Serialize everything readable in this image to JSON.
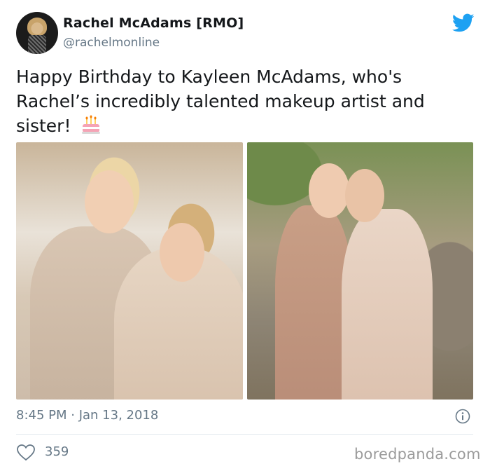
{
  "author": {
    "name": "Rachel McAdams [RMO]",
    "handle": "@rachelmonline"
  },
  "tweet": {
    "text": "Happy Birthday to Kayleen McAdams, who's Rachel’s incredibly talented makeup artist and sister!",
    "emoji": "birthday-cake-icon",
    "timestamp": "8:45 PM · Jan 13, 2018",
    "likes": "359"
  },
  "watermark": "boredpanda.com",
  "colors": {
    "twitter_blue": "#1da1f2",
    "text": "#14171a",
    "secondary": "#657786"
  }
}
